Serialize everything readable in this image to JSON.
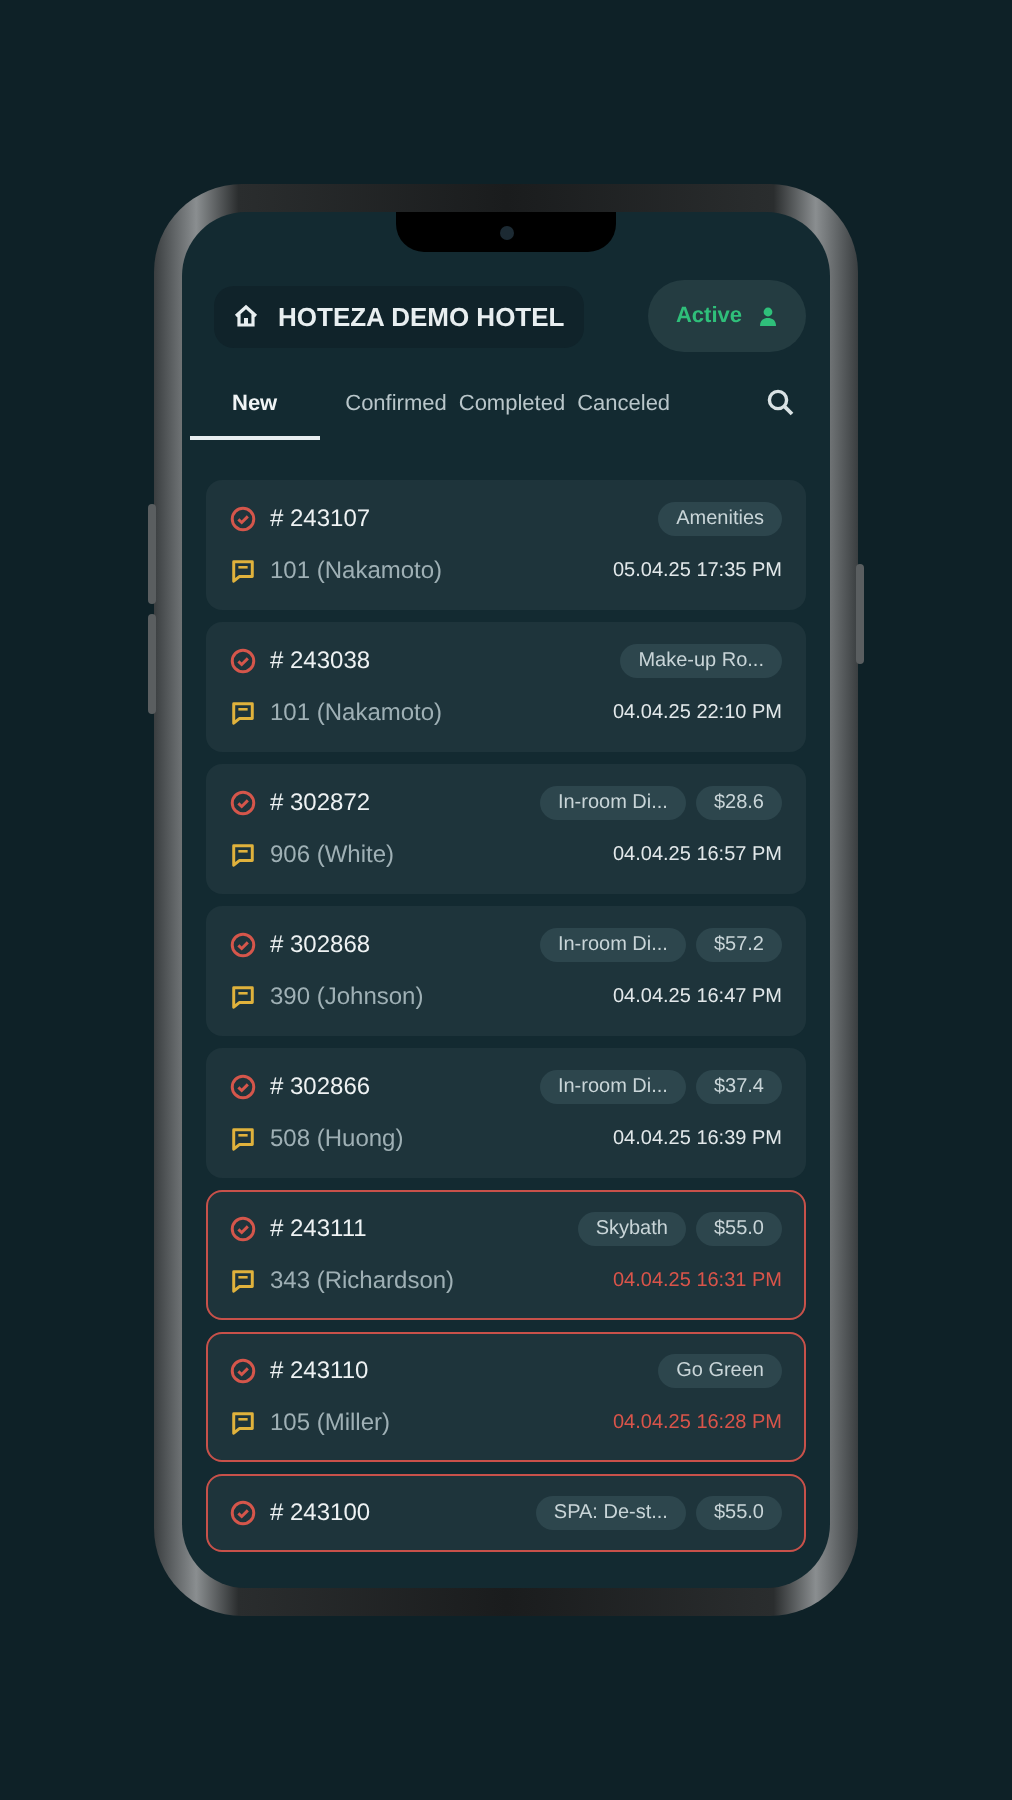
{
  "header": {
    "title": "HOTEZA DEMO HOTEL",
    "status": "Active"
  },
  "tabs": [
    {
      "label": "New",
      "selected": true
    },
    {
      "label": "Confirmed",
      "selected": false
    },
    {
      "label": "Completed",
      "selected": false
    },
    {
      "label": "Canceled",
      "selected": false
    }
  ],
  "orders": [
    {
      "number": "# 243107",
      "room": "101 (Nakamoto)",
      "time": "05.04.25 17:35 PM",
      "tags": [
        "Amenities"
      ],
      "overdue": false
    },
    {
      "number": "# 243038",
      "room": "101 (Nakamoto)",
      "time": "04.04.25 22:10 PM",
      "tags": [
        "Make-up Ro..."
      ],
      "overdue": false
    },
    {
      "number": "# 302872",
      "room": "906 (White)",
      "time": "04.04.25 16:57 PM",
      "tags": [
        "In-room Di...",
        "$28.6"
      ],
      "overdue": false
    },
    {
      "number": "# 302868",
      "room": "390 (Johnson)",
      "time": "04.04.25 16:47 PM",
      "tags": [
        "In-room Di...",
        "$57.2"
      ],
      "overdue": false
    },
    {
      "number": "# 302866",
      "room": "508 (Huong)",
      "time": "04.04.25 16:39 PM",
      "tags": [
        "In-room Di...",
        "$37.4"
      ],
      "overdue": false
    },
    {
      "number": "# 243111",
      "room": "343 (Richardson)",
      "time": "04.04.25 16:31 PM",
      "tags": [
        "Skybath",
        "$55.0"
      ],
      "overdue": true
    },
    {
      "number": "# 243110",
      "room": "105 (Miller)",
      "time": "04.04.25 16:28 PM",
      "tags": [
        "Go Green"
      ],
      "overdue": true
    },
    {
      "number": "# 243100",
      "tags": [
        "SPA: De-st...",
        "$55.0"
      ],
      "overdue": true
    }
  ]
}
